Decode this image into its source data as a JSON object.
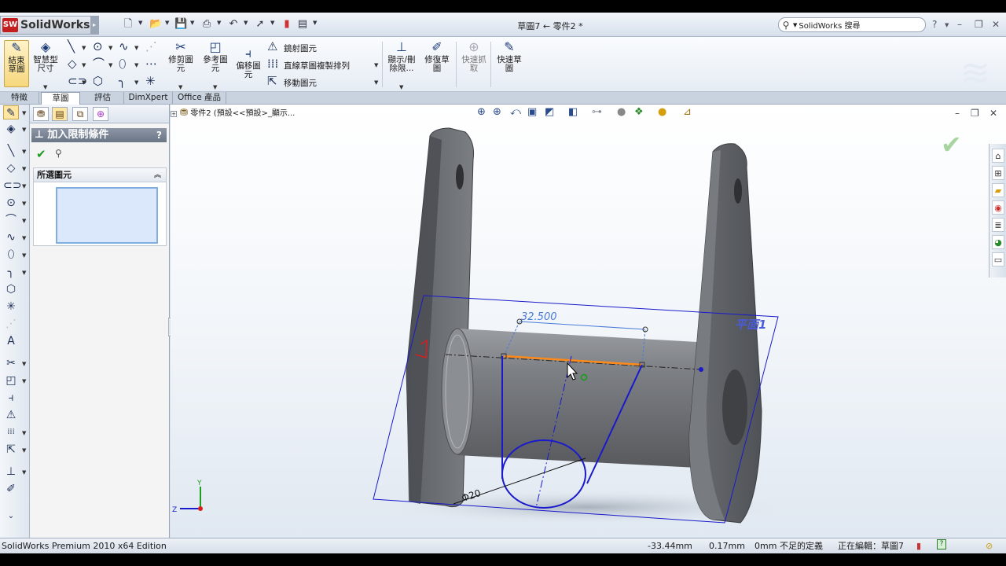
{
  "app": {
    "name": "SolidWorks",
    "logo_badge": "SW",
    "document_title": "草圖7 ← 零件2 *"
  },
  "search": {
    "placeholder": "SolidWorks 搜尋"
  },
  "window_controls": {
    "help": "?",
    "minimize": "–",
    "restore": "❐",
    "close": "✕"
  },
  "commands": {
    "exit_sketch": "結束\n草圖",
    "smart_dimension": "智慧型\n尺寸",
    "trim_entities": "修剪圖\n元",
    "convert_entities": "參考圖\n元",
    "offset_entities": "偏移圖\n元",
    "mirror_entities": "鏡射圖元",
    "linear_pattern": "直線草圖複製排列",
    "move_entities": "移動圖元",
    "display_delete_relations": "顯示/刪\n除限...",
    "repair_sketch": "修復草\n圖",
    "quick_snaps": "快速抓\n取",
    "rapid_sketch": "快速草\n圖"
  },
  "tabs": [
    "特徵",
    "草圖",
    "評估",
    "DimXpert",
    "Office 產品"
  ],
  "active_tab": "草圖",
  "property_manager": {
    "title": "加入限制條件",
    "help": "?",
    "group_label": "所選圖元"
  },
  "feature_tree": {
    "root": "零件2 (預設<<預設>_顯示..."
  },
  "graphics": {
    "dimension_value": "32.500",
    "diameter_label": "Φ20",
    "plane_label": "平面1",
    "triad_y": "Y",
    "triad_z": "Z"
  },
  "status": {
    "edition": "SolidWorks Premium 2010 x64 Edition",
    "x": "-33.44mm",
    "y": "0.17mm",
    "z": "0mm",
    "definition": "不足的定義",
    "editing": "正在編輯：草圖7",
    "help_icon": "?"
  },
  "colors": {
    "title_gradient_top": "#f4f7fb",
    "model_gray": "#6b6e73",
    "sketch_blue": "#1a1acc",
    "selected_orange": "#ff8a1a",
    "ok_green": "#1e9b22"
  }
}
